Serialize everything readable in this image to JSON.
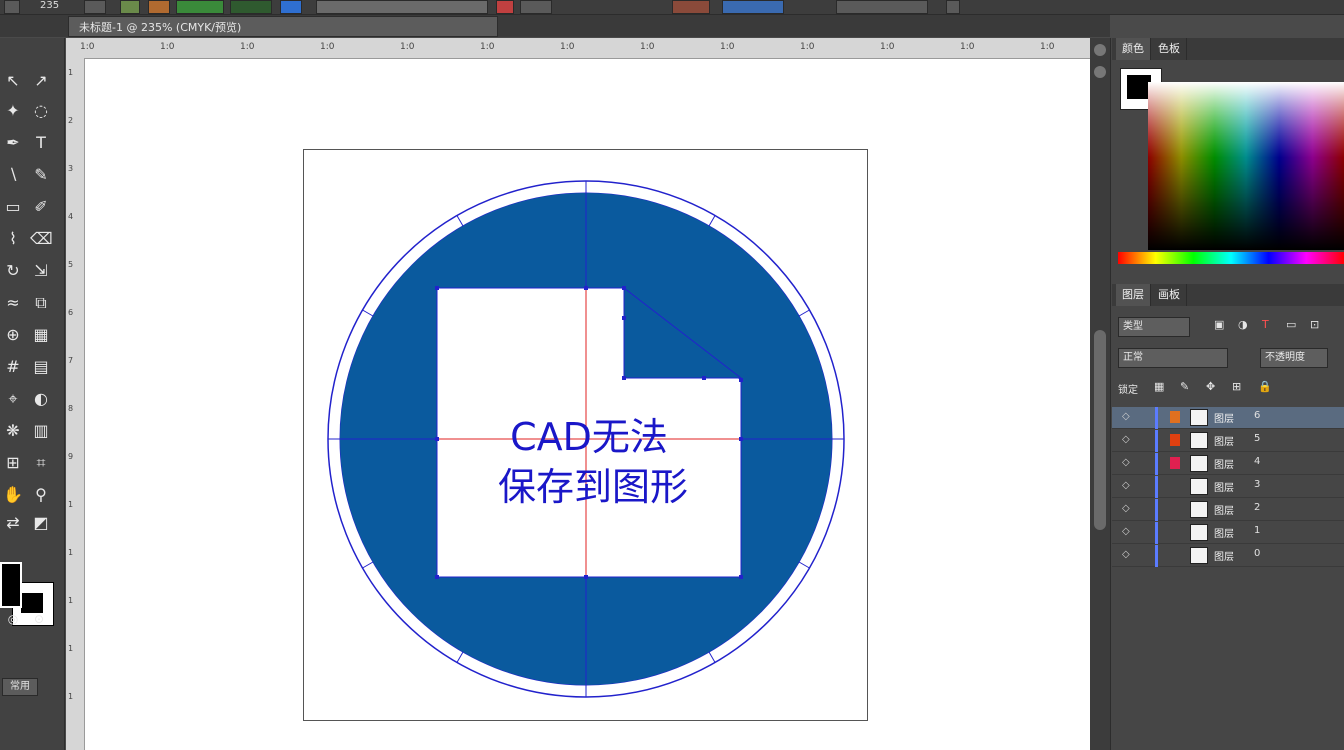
{
  "option_bar": {
    "zoom_value": "235"
  },
  "document_tab": {
    "title": "未标题-1 @ 235% (CMYK/预览)"
  },
  "ruler": {
    "horizontal_ticks": [
      "1:0",
      "1:0",
      "1:0",
      "1:0",
      "1:0",
      "1:0",
      "1:0",
      "1:0",
      "1:0",
      "1:0",
      "1:0",
      "1:0",
      "1:0"
    ],
    "vertical_ticks": [
      "1",
      "2",
      "3",
      "4",
      "5",
      "6",
      "7",
      "8",
      "9",
      "1",
      "1",
      "1",
      "1",
      "1"
    ]
  },
  "artwork": {
    "headline_line1": "CAD无法",
    "headline_line2": "保存到图形",
    "colors": {
      "circle_fill": "#0a5a9e",
      "text": "#1a17c8",
      "guide_blue": "#2222cc",
      "guide_red": "#e02020"
    }
  },
  "toolbox": {
    "mode_label": "常用"
  },
  "color_panel": {
    "tabs": [
      "颜色",
      "色板"
    ],
    "fill_color": "#000000"
  },
  "layers_panel": {
    "tabs": [
      "图层",
      "画板"
    ],
    "filter_label": "类型",
    "blend_label": "正常",
    "opacity_label": "不透明度",
    "lock_label": "锁定",
    "rows": [
      {
        "name": "图层",
        "count": "6",
        "selected": true,
        "mark_color": "#e07020"
      },
      {
        "name": "图层",
        "count": "5",
        "selected": false,
        "mark_color": "#e04010"
      },
      {
        "name": "图层",
        "count": "4",
        "selected": false,
        "mark_color": "#e02050"
      },
      {
        "name": "图层",
        "count": "3",
        "selected": false,
        "mark_color": ""
      },
      {
        "name": "图层",
        "count": "2",
        "selected": false,
        "mark_color": ""
      },
      {
        "name": "图层",
        "count": "1",
        "selected": false,
        "mark_color": ""
      },
      {
        "name": "图层",
        "count": "0",
        "selected": false,
        "mark_color": ""
      }
    ]
  }
}
